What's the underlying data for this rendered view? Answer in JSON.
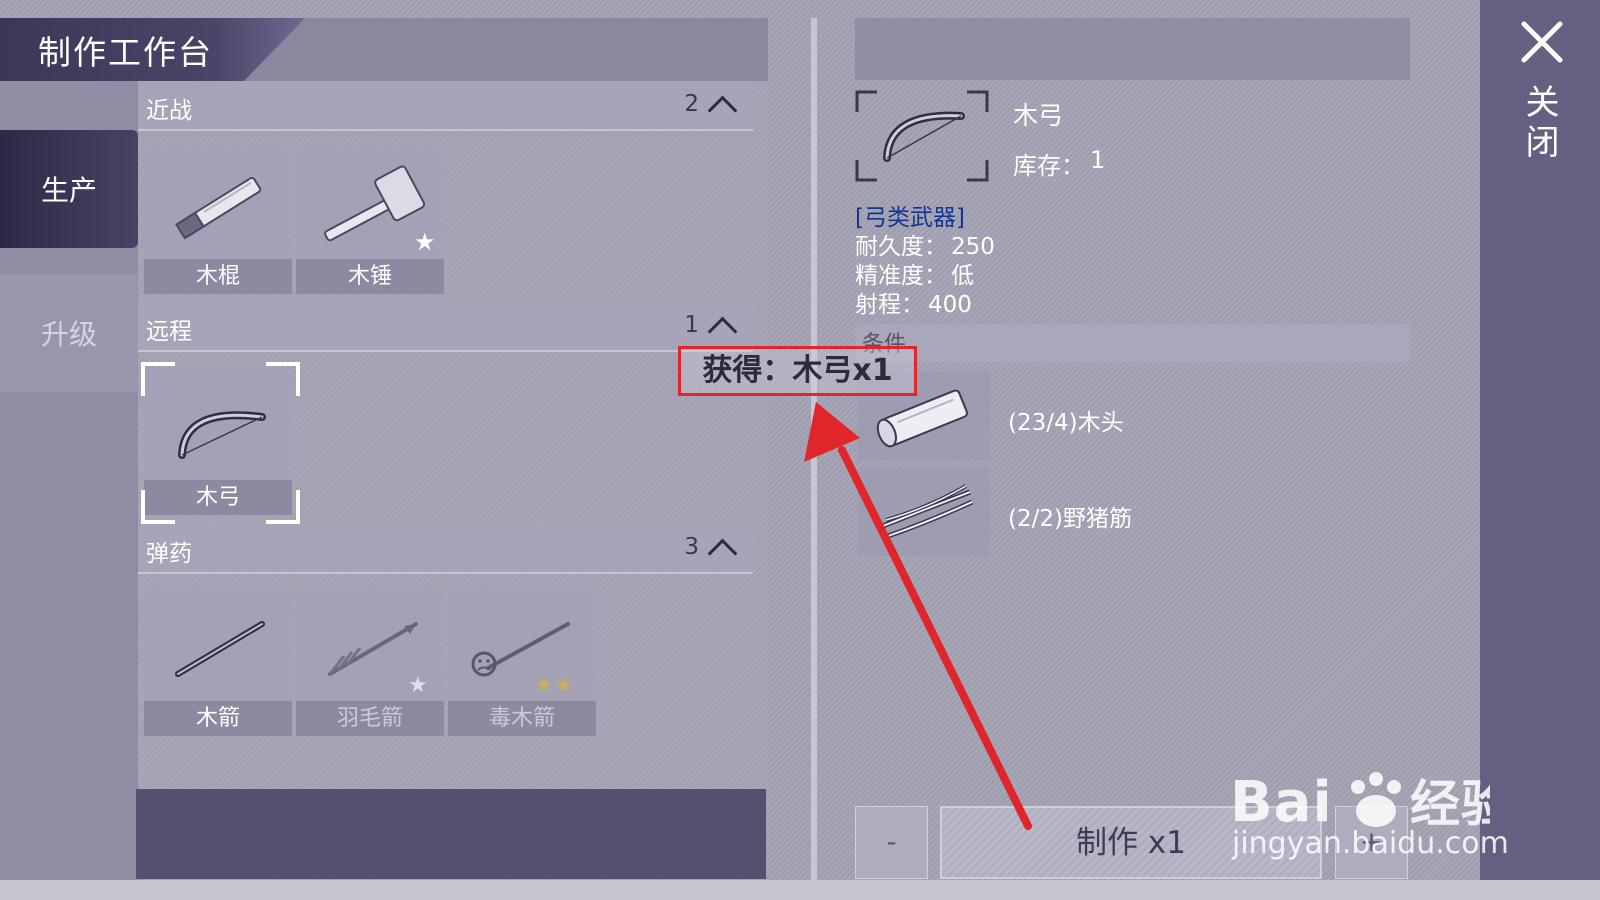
{
  "title": "制作工作台",
  "tabs": [
    {
      "label": "生产",
      "active": true
    },
    {
      "label": "升级",
      "active": false
    }
  ],
  "categories": [
    {
      "name": "近战",
      "count": "2",
      "items": [
        {
          "label": "木棍",
          "icon": "wooden-stick-icon",
          "stars": 0,
          "unlocked": true
        },
        {
          "label": "木锤",
          "icon": "wooden-hammer-icon",
          "stars": 1,
          "unlocked": true
        }
      ]
    },
    {
      "name": "远程",
      "count": "1",
      "items": [
        {
          "label": "木弓",
          "icon": "wooden-bow-icon",
          "stars": 0,
          "unlocked": true,
          "selected": true
        }
      ]
    },
    {
      "name": "弹药",
      "count": "3",
      "items": [
        {
          "label": "木箭",
          "icon": "wooden-arrow-icon",
          "stars": 0,
          "unlocked": true
        },
        {
          "label": "羽毛箭",
          "icon": "feather-arrow-icon",
          "stars": 1,
          "unlocked": false
        },
        {
          "label": "毒木箭",
          "icon": "poison-arrow-icon",
          "stars": 2,
          "unlocked": false
        }
      ]
    }
  ],
  "detail": {
    "name": "木弓",
    "stock_label": "库存：",
    "stock_value": "1",
    "type": "[弓类武器]",
    "stats": [
      {
        "label": "耐久度：",
        "value": "250"
      },
      {
        "label": "精准度：",
        "value": "低"
      },
      {
        "label": "射程：",
        "value": "400"
      }
    ],
    "conditions_label": "条件",
    "materials": [
      {
        "text": "(23/4)木头",
        "icon": "wood-log-icon"
      },
      {
        "text": "(2/2)野猪筋",
        "icon": "boar-tendon-icon"
      }
    ]
  },
  "buttons": {
    "minus": "-",
    "craft": "制作 x1",
    "plus": "+"
  },
  "close_label": "关闭",
  "annotation": "获得：木弓x1",
  "watermark": {
    "logo": "Bai  经验",
    "url": "jingyan.baidu.com"
  },
  "colors": {
    "accent_dark": "#3d3656",
    "annotation_red": "#e0262a",
    "type_blue": "#17348f"
  }
}
